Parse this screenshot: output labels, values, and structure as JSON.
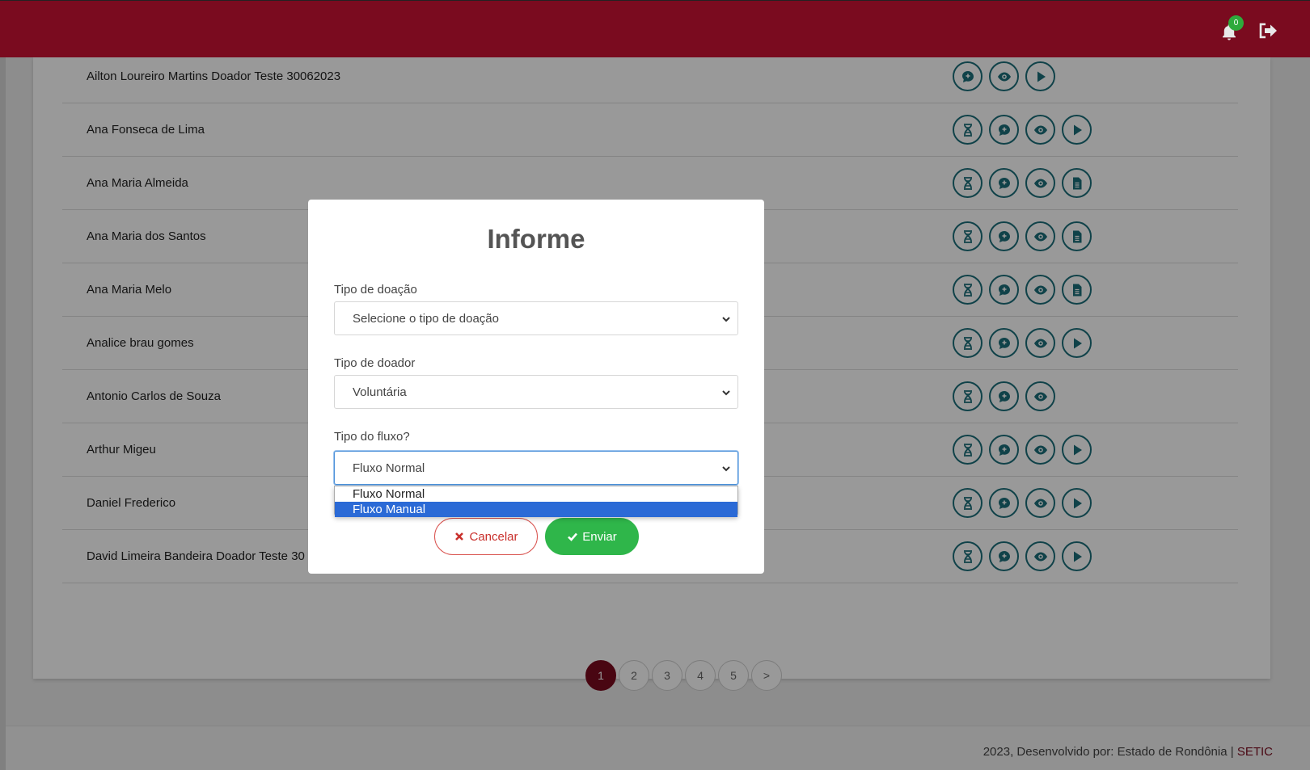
{
  "header": {
    "notification_count": "0",
    "icons": [
      "bell-icon",
      "logout-icon"
    ],
    "brand_color": "#7a0b1f"
  },
  "donors": [
    {
      "name": "Ailton Loureiro Martins Doador Teste 30062023",
      "actions": [
        "chat-icon",
        "eye-icon",
        "play-icon"
      ]
    },
    {
      "name": "Ana Fonseca de Lima",
      "actions": [
        "dna-icon",
        "chat-icon",
        "eye-icon",
        "play-icon"
      ]
    },
    {
      "name": "Ana Maria Almeida",
      "actions": [
        "dna-icon",
        "chat-icon",
        "eye-icon",
        "document-icon"
      ]
    },
    {
      "name": "Ana Maria dos Santos",
      "actions": [
        "dna-icon",
        "chat-icon",
        "eye-icon",
        "document-icon"
      ]
    },
    {
      "name": "Ana Maria Melo",
      "actions": [
        "dna-icon",
        "chat-icon",
        "eye-icon",
        "document-icon"
      ]
    },
    {
      "name": "Analice brau gomes",
      "actions": [
        "dna-icon",
        "chat-icon",
        "eye-icon",
        "play-icon"
      ]
    },
    {
      "name": "Antonio Carlos de Souza",
      "actions": [
        "dna-icon",
        "chat-icon",
        "eye-icon"
      ]
    },
    {
      "name": "Arthur Migeu",
      "actions": [
        "dna-icon",
        "chat-icon",
        "eye-icon",
        "play-icon"
      ]
    },
    {
      "name": "Daniel Frederico",
      "actions": [
        "dna-icon",
        "chat-icon",
        "eye-icon",
        "play-icon"
      ]
    },
    {
      "name": "David Limeira Bandeira Doador Teste 30",
      "actions": [
        "dna-icon",
        "chat-icon",
        "eye-icon",
        "play-icon"
      ]
    }
  ],
  "pagination": {
    "pages": [
      "1",
      "2",
      "3",
      "4",
      "5",
      ">"
    ],
    "active": "1"
  },
  "footer": {
    "text": "2023, Desenvolvido por: Estado de Rondônia | ",
    "brand": "SETIC"
  },
  "modal": {
    "title": "Informe",
    "donation_type_label": "Tipo de doação",
    "donation_type_value": "Selecione o tipo de doação",
    "donor_type_label": "Tipo de doador",
    "donor_type_value": "Voluntária",
    "flow_type_label": "Tipo do fluxo?",
    "flow_type_value": "Fluxo Normal",
    "flow_options": [
      "Fluxo Normal",
      "Fluxo Manual"
    ],
    "highlighted_option": "Fluxo Manual",
    "cancel_label": "Cancelar",
    "send_label": "Enviar",
    "accent_colors": {
      "cancel": "#c9302c",
      "send": "#2fb64a",
      "highlight": "#2b6ad6"
    }
  }
}
